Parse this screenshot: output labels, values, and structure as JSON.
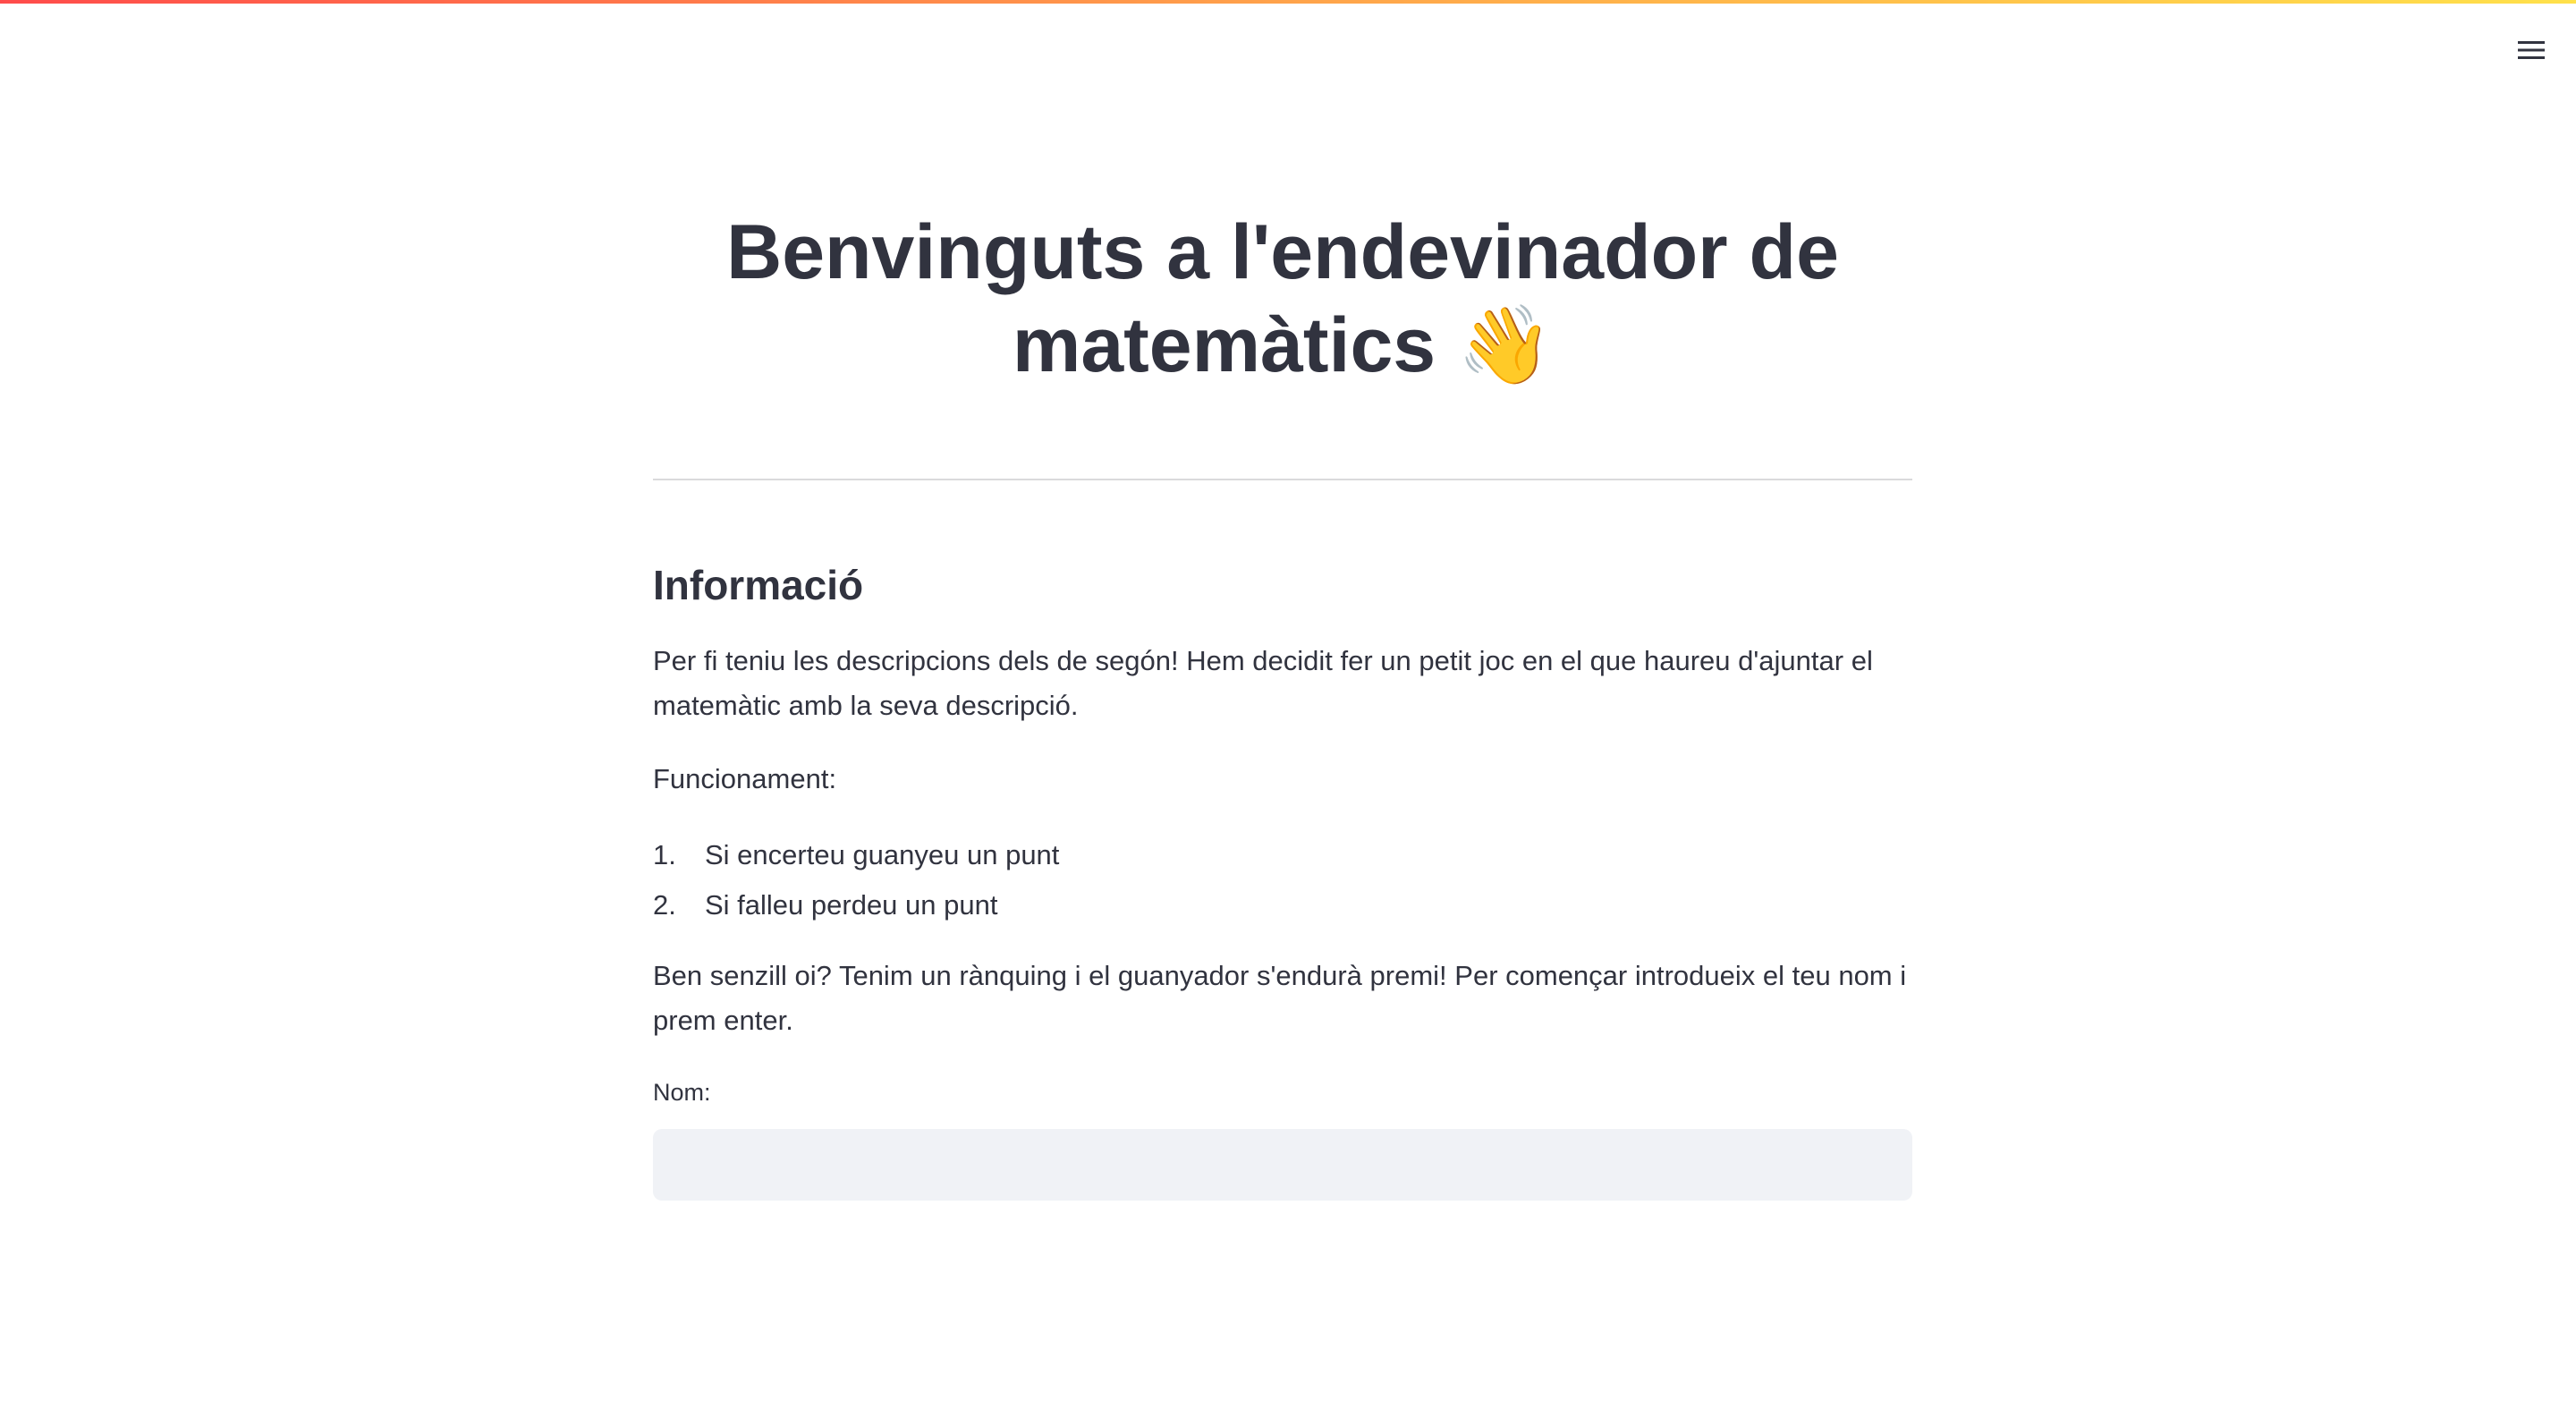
{
  "header": {
    "menu_icon": "hamburger-menu-icon",
    "accent_gradient": [
      "#ff4b4b",
      "#ffa34b",
      "#ffe14b"
    ]
  },
  "main": {
    "title_line1": "Benvinguts a l'endevinador de",
    "title_line2": "matemàtics",
    "title_emoji": "👋",
    "subheader": "Informació",
    "intro": "Per fi teniu les descripcions dels de segón! Hem decidit fer un petit joc en el que haureu d'ajuntar el matemàtic amb la seva descripció.",
    "funcionament_label": "Funcionament:",
    "rules": [
      {
        "num": "1.",
        "text": "Si encerteu guanyeu un punt"
      },
      {
        "num": "2.",
        "text": "Si falleu perdeu un punt"
      }
    ],
    "outro": "Ben senzill oi? Tenim un rànquing i el guanyador s'endurà premi! Per començar introdueix el teu nom i prem enter.",
    "name_input": {
      "label": "Nom:",
      "value": "",
      "placeholder": ""
    }
  }
}
